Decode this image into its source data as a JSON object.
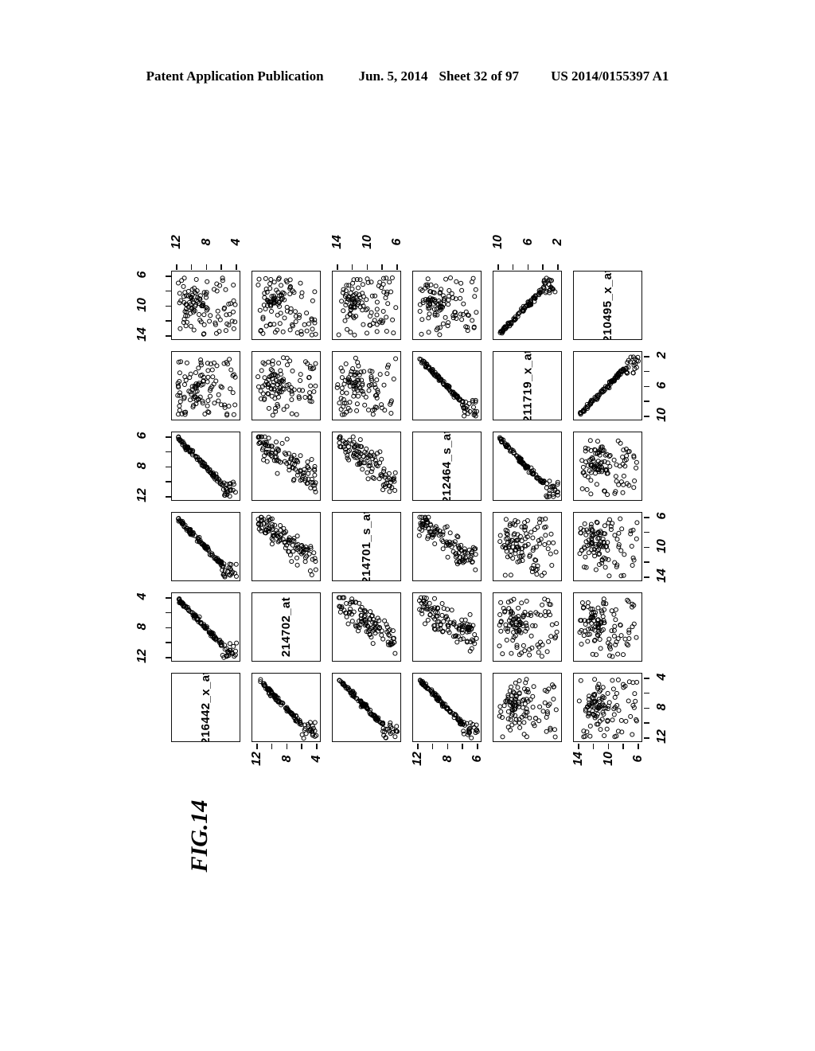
{
  "header": {
    "publication": "Patent Application Publication",
    "date": "Jun. 5, 2014",
    "sheet": "Sheet 32 of 97",
    "patent_number": "US 2014/0155397 A1"
  },
  "figure": {
    "number": "FIG.14",
    "type": "scatterplot-matrix",
    "variables": [
      "216442_x_at",
      "214702_at",
      "214701_s_at",
      "212464_s_at",
      "211719_x_at",
      "210495_x_at"
    ]
  },
  "chart_data": {
    "type": "scatter",
    "title": "FIG.14",
    "matrix": "6x6 pairwise scatterplot matrix (pairs plot)",
    "variables": [
      "216442_x_at",
      "214702_at",
      "214701_s_at",
      "212464_s_at",
      "211719_x_at",
      "210495_x_at"
    ],
    "axis_ranges": {
      "216442_x_at": [
        2,
        14
      ],
      "214702_at": [
        1,
        12
      ],
      "214701_s_at": [
        5,
        13
      ],
      "212464_s_at": [
        5,
        15
      ],
      "211719_x_at": [
        3,
        13
      ],
      "210495_x_at": [
        3,
        13
      ]
    },
    "tick_labels": {
      "216442_x_at": [
        "6",
        "10",
        "14"
      ],
      "214702_at": [
        "2",
        "6",
        "10"
      ],
      "214701_s_at": [
        "6",
        "8",
        "12"
      ],
      "212464_s_at": [
        "6",
        "10",
        "14"
      ],
      "211719_x_at": [
        "4",
        "8",
        "12"
      ],
      "210495_x_at": [
        "4",
        "8",
        "12"
      ]
    },
    "top_axis_labels": [
      [
        "12",
        "8",
        "4"
      ],
      null,
      [
        "14",
        "10",
        "6"
      ],
      null,
      [
        "10",
        "6",
        "2"
      ],
      null
    ],
    "bottom_axis_labels": [
      null,
      [
        "12",
        "8",
        "4"
      ],
      null,
      [
        "12",
        "8",
        "6"
      ],
      null,
      [
        "14",
        "10",
        "6"
      ]
    ],
    "left_axis_labels": [
      [
        "6",
        "10",
        "14"
      ],
      null,
      [
        "6",
        "8",
        "12"
      ],
      null,
      [
        "4",
        "8",
        "12"
      ],
      null
    ],
    "right_axis_labels": [
      null,
      [
        "2",
        "6",
        "10"
      ],
      null,
      [
        "6",
        "10",
        "14"
      ],
      null,
      [
        "4",
        "8",
        "12"
      ]
    ],
    "relationships": [
      {
        "pair": [
          "216442_x_at",
          "214702_at"
        ],
        "pattern": "strong negative linear"
      },
      {
        "pair": [
          "216442_x_at",
          "214701_s_at"
        ],
        "pattern": "strong negative linear"
      },
      {
        "pair": [
          "216442_x_at",
          "212464_s_at"
        ],
        "pattern": "strong negative linear"
      },
      {
        "pair": [
          "216442_x_at",
          "211719_x_at"
        ],
        "pattern": "diffuse cloud"
      },
      {
        "pair": [
          "216442_x_at",
          "210495_x_at"
        ],
        "pattern": "diffuse cloud"
      },
      {
        "pair": [
          "214702_at",
          "214701_s_at"
        ],
        "pattern": "diffuse negative cloud"
      },
      {
        "pair": [
          "214702_at",
          "212464_s_at"
        ],
        "pattern": "diffuse negative cloud"
      },
      {
        "pair": [
          "214701_s_at",
          "212464_s_at"
        ],
        "pattern": "diffuse negative cloud"
      },
      {
        "pair": [
          "212464_s_at",
          "211719_x_at"
        ],
        "pattern": "strong negative linear"
      },
      {
        "pair": [
          "211719_x_at",
          "210495_x_at"
        ],
        "pattern": "strong positive linear"
      }
    ],
    "marker": "open circle",
    "n_points_per_panel": 110,
    "grid": false,
    "legend": "none"
  }
}
